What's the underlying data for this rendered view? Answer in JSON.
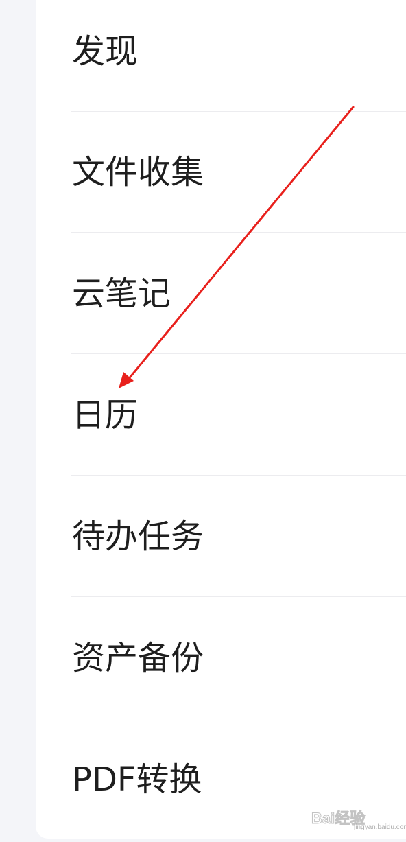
{
  "menu": {
    "items": [
      {
        "label": "发现"
      },
      {
        "label": "文件收集"
      },
      {
        "label": "云笔记"
      },
      {
        "label": "日历"
      },
      {
        "label": "待办任务"
      },
      {
        "label": "资产备份"
      },
      {
        "label": "PDF转换"
      }
    ]
  },
  "annotation": {
    "arrow_color": "#e8201c",
    "arrow_target": "日历"
  },
  "watermark": {
    "brand": "Bai经验",
    "sub": "jingyan.baidu.com"
  },
  "colors": {
    "page_background": "#f4f5f9",
    "panel_background": "#ffffff",
    "text": "#1e1e1e",
    "divider": "#ececef"
  }
}
